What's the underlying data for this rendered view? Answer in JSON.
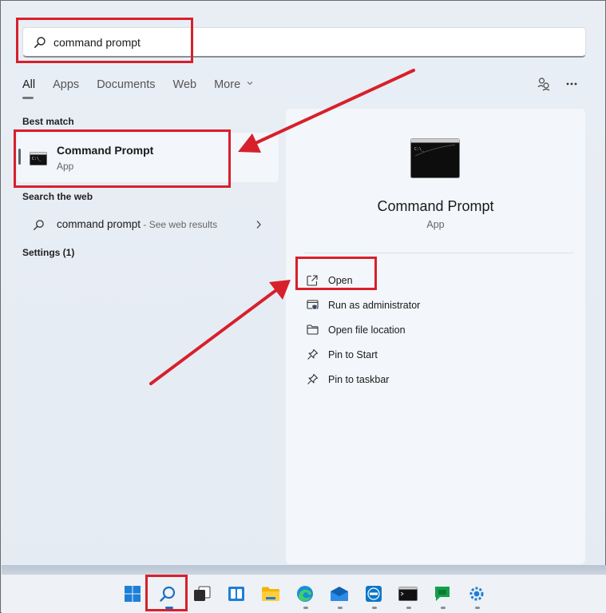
{
  "search": {
    "value": "command prompt"
  },
  "tabs": [
    {
      "label": "All"
    },
    {
      "label": "Apps"
    },
    {
      "label": "Documents"
    },
    {
      "label": "Web"
    },
    {
      "label": "More"
    }
  ],
  "sections": {
    "best_match": "Best match",
    "search_web": "Search the web",
    "settings": "Settings (1)"
  },
  "best_match": {
    "name": "Command Prompt",
    "type": "App"
  },
  "web_result": {
    "query": "command prompt",
    "suffix": " - See web results"
  },
  "preview": {
    "title": "Command Prompt",
    "type": "App",
    "actions": [
      {
        "label": "Open",
        "icon": "open-external-icon"
      },
      {
        "label": "Run as administrator",
        "icon": "shield-admin-icon"
      },
      {
        "label": "Open file location",
        "icon": "folder-icon"
      },
      {
        "label": "Pin to Start",
        "icon": "pin-icon"
      },
      {
        "label": "Pin to taskbar",
        "icon": "pin-icon"
      }
    ]
  },
  "taskbar": {
    "icons": [
      "windows-start-icon",
      "search-icon",
      "task-view-icon",
      "widgets-icon",
      "file-explorer-icon",
      "edge-browser-icon",
      "mail-icon",
      "dell-icon",
      "terminal-icon",
      "chat-icon",
      "settings-app-icon"
    ]
  },
  "colors": {
    "annotation": "#d7202b",
    "accent": "#5a6470"
  }
}
